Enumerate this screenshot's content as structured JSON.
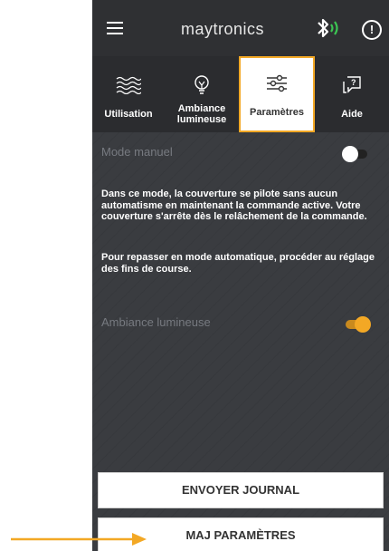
{
  "header": {
    "logo": "maytronics"
  },
  "tabs": [
    {
      "label": "Utilisation",
      "icon": "waves-icon"
    },
    {
      "label": "Ambiance lumineuse",
      "icon": "bulb-icon"
    },
    {
      "label": "Paramètres",
      "icon": "sliders-icon",
      "active": true
    },
    {
      "label": "Aide",
      "icon": "help-icon"
    }
  ],
  "settings": {
    "manual_mode_label": "Mode manuel",
    "manual_mode_on": false,
    "description_1": "Dans ce mode, la couverture se pilote sans aucun automatisme en maintenant la commande active. Votre couverture s'arrête dès le relâchement de la commande.",
    "description_2": "Pour repasser en mode automatique, procéder au réglage des fins de course.",
    "ambiance_label": "Ambiance lumineuse",
    "ambiance_on": true
  },
  "buttons": {
    "send_log": "ENVOYER JOURNAL",
    "update_params": "MAJ PARAMÈTRES"
  },
  "colors": {
    "accent": "#f3a825",
    "bluetooth": "#ffffff",
    "signal": "#3cc453",
    "background": "#3a3c40"
  }
}
